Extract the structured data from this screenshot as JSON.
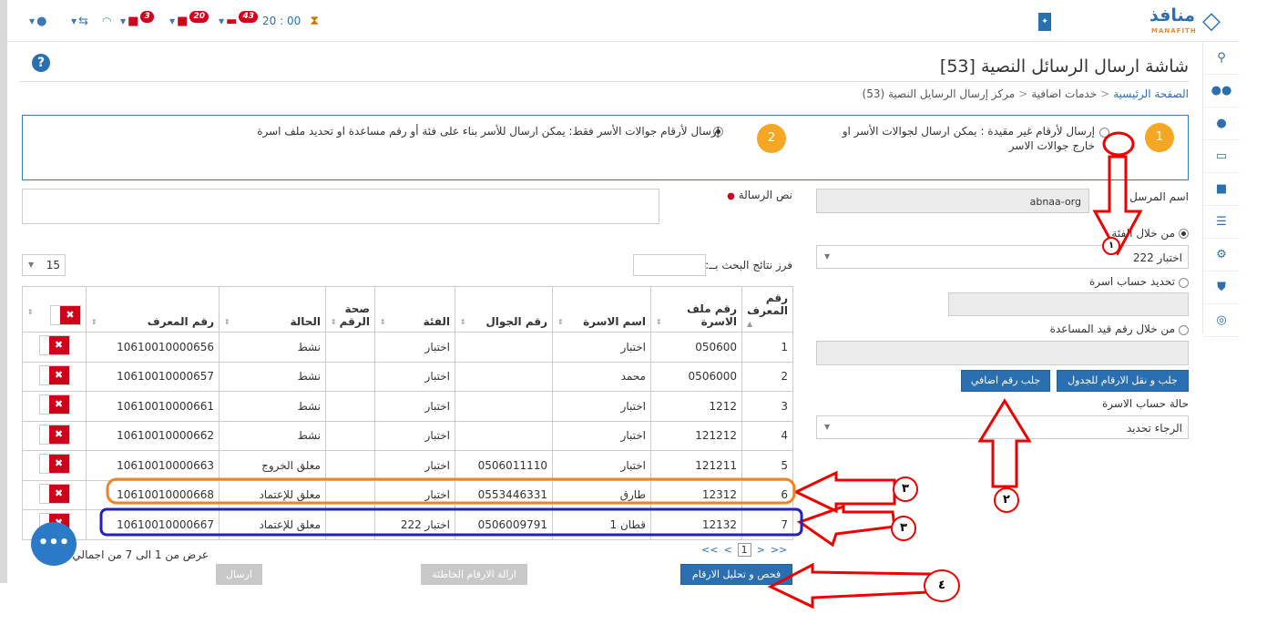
{
  "topbar": {
    "time": "20 : 00",
    "badge_a": "43",
    "badge_b": "20",
    "badge_c": "3"
  },
  "logo": {
    "arabic": "منافذ",
    "english": "MANAFITH"
  },
  "page": {
    "title": "شاشة ارسال الرسائل النصية [53]",
    "breadcrumb": [
      "الصفحة الرئيسية",
      "خدمات اضافية",
      "مركز إرسال الرسايل النصية (53)"
    ]
  },
  "options": {
    "opt1": "إرسال لأرقام غير مقيدة : يمكن ارسال لجوالات الأسر او خارج جوالات الاسر",
    "opt1_num": "1",
    "opt2": "إرسال لأرقام جوالات الأسر فقط: يمكن ارسال للأسر بناء على فئة أو رقم مساعدة او تحديد ملف اسرة",
    "opt2_num": "2"
  },
  "form": {
    "sender_label": "اسم المرسل",
    "sender_value": "abnaa-org",
    "message_label": "نص الرسالة",
    "by_category_label": "من خلال الفئة",
    "category_value": "اختبار 222",
    "select_family_label": "تحديد حساب اسرة",
    "by_aid_label": "من خلال رقم قيد المساعدة",
    "fetch_move_button": "جلب و نقل الارقام للجدول",
    "fetch_extra_button": "جلب رقم اضافي",
    "family_status_label": "حالة حساب الاسرة",
    "family_status_value": "الرجاء تحديد",
    "filter_label": "فرز نتائج البحث بــ:",
    "page_size": "15"
  },
  "table": {
    "headers": [
      "رقم المعرف",
      "رقم ملف الاسرة",
      "اسم الاسرة",
      "رقم الجوال",
      "الفئة",
      "صحة الرقم",
      "الحالة",
      "رقم المعرف",
      ""
    ],
    "rows": [
      [
        "1",
        "050600",
        "اختبار",
        "",
        "اختبار",
        "",
        "نشط",
        "10610010000656"
      ],
      [
        "2",
        "0506000",
        "محمد",
        "",
        "اختبار",
        "",
        "نشط",
        "10610010000657"
      ],
      [
        "3",
        "1212",
        "اختبار",
        "",
        "اختبار",
        "",
        "نشط",
        "10610010000661"
      ],
      [
        "4",
        "121212",
        "اختبار",
        "",
        "اختبار",
        "",
        "نشط",
        "10610010000662"
      ],
      [
        "5",
        "121211",
        "اختبار",
        "0506011110",
        "اختبار",
        "",
        "معلق الخروج",
        "10610010000663"
      ],
      [
        "6",
        "12312",
        "طارق",
        "0553446331",
        "اختبار",
        "",
        "معلق للإعتماد",
        "10610010000668"
      ],
      [
        "7",
        "12132",
        "قطان 1",
        "0506009791",
        "اختبار 222",
        "",
        "معلق للإعتماد",
        "10610010000667"
      ]
    ],
    "delete_glyph": "✖"
  },
  "pager": {
    "first": "<<",
    "prev": "<",
    "current": "1",
    "next": ">",
    "last": ">>"
  },
  "summary": "عرض من 1 الى 7 من اجمالي 7",
  "actions": {
    "analyze": "فحص و تحليل الارقام",
    "remove_wrong": "ازالة الارقام الخاطئة",
    "send": "ارسال"
  },
  "annotations": {
    "a1": "١",
    "a2": "٢",
    "a3a": "٣",
    "a3b": "٣",
    "a4": "٤"
  }
}
